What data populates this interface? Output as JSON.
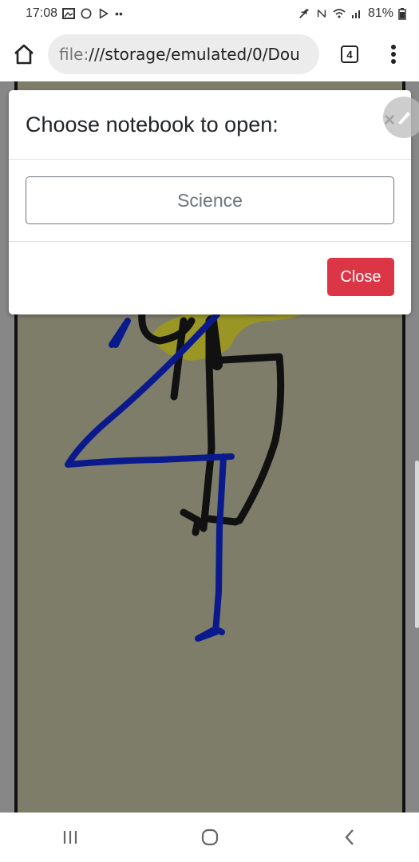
{
  "status_bar": {
    "time": "17:08",
    "battery": "81%"
  },
  "browser": {
    "url_scheme": "file:",
    "url_path": "///storage/emulated/0/Dou",
    "tab_count": "4"
  },
  "modal": {
    "title": "Choose notebook to open:",
    "close_x": "×",
    "notebooks": [
      "Science"
    ],
    "close_label": "Close"
  },
  "colors": {
    "danger": "#dc3545",
    "page_background": "#7e7d6a",
    "ink_blue": "#0a1a8c",
    "ink_black": "#111111",
    "ink_yellow": "#9e9a1a"
  },
  "icons": {
    "home": "home-icon",
    "menu": "more-vert-icon",
    "edit": "pencil-icon",
    "nav_recent": "recent-apps-icon",
    "nav_home": "home-circle-icon",
    "nav_back": "back-chevron-icon"
  }
}
